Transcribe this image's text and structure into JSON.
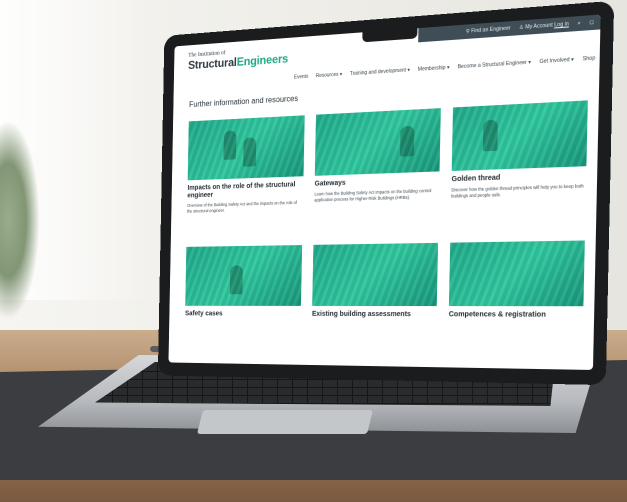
{
  "site": {
    "logo_line1": "The Institution of",
    "logo_word1": "Structural",
    "logo_word2": "Engineers",
    "brand_color": "#1ea985"
  },
  "utility_bar": {
    "find_engineer": "Find an Engineer",
    "my_account": "My Account",
    "log_in": "Log in",
    "search_icon": "search-icon",
    "basket_icon": "basket-icon"
  },
  "nav": {
    "items": [
      {
        "label": "Events"
      },
      {
        "label": "Resources ▾"
      },
      {
        "label": "Training and development ▾"
      },
      {
        "label": "Membership ▾"
      },
      {
        "label": "Become a Structural Engineer ▾"
      },
      {
        "label": "Get Involved ▾"
      },
      {
        "label": "Shop"
      }
    ]
  },
  "main": {
    "section_title": "Further information and resources",
    "cards": [
      {
        "title": "Impacts on the role of the structural engineer",
        "desc": "Overview of the Building Safety Act and the impacts on the role of the structural engineer."
      },
      {
        "title": "Gateways",
        "desc": "Learn how the Building Safety Act impacts on the building control application process for Higher-Risk Buildings (HRBs)."
      },
      {
        "title": "Golden thread",
        "desc": "Discover how the golden thread principles will help you to keep both buildings and people safe."
      },
      {
        "title": "Safety cases",
        "desc": ""
      },
      {
        "title": "Existing building assessments",
        "desc": ""
      },
      {
        "title": "Competences & registration",
        "desc": ""
      }
    ]
  }
}
